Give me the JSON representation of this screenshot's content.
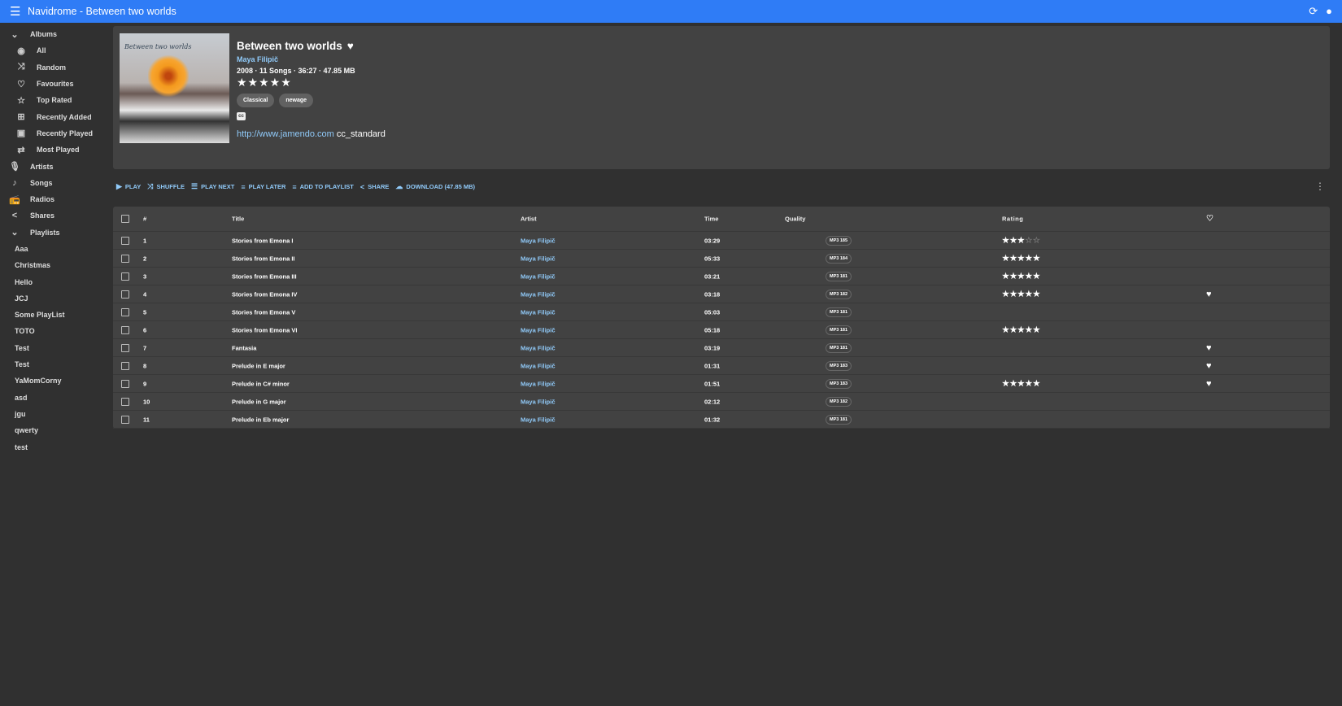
{
  "app": {
    "title": "Navidrome - Between two worlds"
  },
  "sidebar": {
    "albums_label": "Albums",
    "album_items": [
      {
        "label": "All",
        "icon": "album-icon"
      },
      {
        "label": "Random",
        "icon": "shuffle-icon"
      },
      {
        "label": "Favourites",
        "icon": "heart-icon"
      },
      {
        "label": "Top Rated",
        "icon": "star-icon"
      },
      {
        "label": "Recently Added",
        "icon": "library-add-icon"
      },
      {
        "label": "Recently Played",
        "icon": "library-play-icon"
      },
      {
        "label": "Most Played",
        "icon": "repeat-icon"
      }
    ],
    "sections": [
      {
        "label": "Artists"
      },
      {
        "label": "Songs"
      },
      {
        "label": "Radios"
      },
      {
        "label": "Shares"
      }
    ],
    "playlists_label": "Playlists",
    "playlists": [
      "Aaa",
      "Christmas",
      "Hello",
      "JCJ",
      "Some PlayList",
      "TOTO",
      "Test",
      "Test",
      "YaMomCorny",
      "asd",
      "jgu",
      "qwerty",
      "test"
    ]
  },
  "album": {
    "title": "Between two worlds",
    "artist": "Maya Filipič",
    "meta": "2008 · 11 Songs · 36:27 · 47.85 MB",
    "rating": 5,
    "genres": [
      "Classical",
      "newage"
    ],
    "cc": "cc",
    "url": "http://www.jamendo.com",
    "license": "cc_standard",
    "cover_text": "Between two worlds"
  },
  "toolbar": {
    "play": "PLAY",
    "shuffle": "SHUFFLE",
    "play_next": "PLAY NEXT",
    "play_later": "PLAY LATER",
    "add_to_playlist": "ADD TO PLAYLIST",
    "share": "SHARE",
    "download": "DOWNLOAD (47.85 MB)"
  },
  "table": {
    "headers": {
      "num": "#",
      "title": "Title",
      "artist": "Artist",
      "time": "Time",
      "quality": "Quality",
      "rating": "Rating"
    },
    "rows": [
      {
        "num": "1",
        "title": "Stories from Emona I",
        "artist": "Maya Filipič",
        "time": "03:29",
        "quality": "MP3 185",
        "rating": 3,
        "loved": false
      },
      {
        "num": "2",
        "title": "Stories from Emona II",
        "artist": "Maya Filipič",
        "time": "05:33",
        "quality": "MP3 184",
        "rating": 5,
        "loved": false
      },
      {
        "num": "3",
        "title": "Stories from Emona III",
        "artist": "Maya Filipič",
        "time": "03:21",
        "quality": "MP3 181",
        "rating": 5,
        "loved": false
      },
      {
        "num": "4",
        "title": "Stories from Emona IV",
        "artist": "Maya Filipič",
        "time": "03:18",
        "quality": "MP3 182",
        "rating": 5,
        "loved": true
      },
      {
        "num": "5",
        "title": "Stories from Emona V",
        "artist": "Maya Filipič",
        "time": "05:03",
        "quality": "MP3 181",
        "rating": 0,
        "loved": false
      },
      {
        "num": "6",
        "title": "Stories from Emona VI",
        "artist": "Maya Filipič",
        "time": "05:18",
        "quality": "MP3 181",
        "rating": 5,
        "loved": false
      },
      {
        "num": "7",
        "title": "Fantasia",
        "artist": "Maya Filipič",
        "time": "03:19",
        "quality": "MP3 181",
        "rating": 0,
        "loved": true
      },
      {
        "num": "8",
        "title": "Prelude in E major",
        "artist": "Maya Filipič",
        "time": "01:31",
        "quality": "MP3 183",
        "rating": 0,
        "loved": true
      },
      {
        "num": "9",
        "title": "Prelude in C# minor",
        "artist": "Maya Filipič",
        "time": "01:51",
        "quality": "MP3 183",
        "rating": 5,
        "loved": true
      },
      {
        "num": "10",
        "title": "Prelude in G major",
        "artist": "Maya Filipič",
        "time": "02:12",
        "quality": "MP3 182",
        "rating": 0,
        "loved": false
      },
      {
        "num": "11",
        "title": "Prelude in Eb major",
        "artist": "Maya Filipič",
        "time": "01:32",
        "quality": "MP3 181",
        "rating": 0,
        "loved": false
      }
    ]
  },
  "colors": {
    "appbar": "#2f7cf6",
    "background": "#303030",
    "card": "#424242",
    "link": "#90caf9"
  }
}
